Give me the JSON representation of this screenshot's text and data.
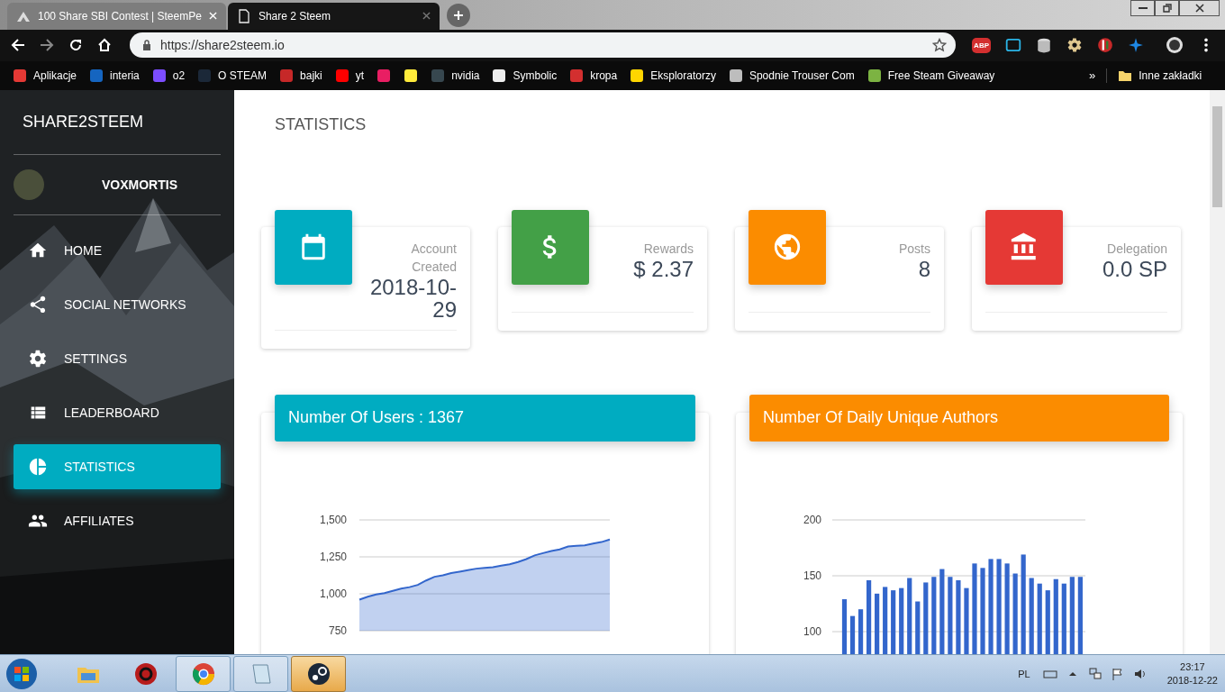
{
  "browser": {
    "tabs": [
      {
        "title": "100 Share SBI Contest | SteemPe",
        "selected": false
      },
      {
        "title": "Share 2 Steem",
        "selected": true
      }
    ],
    "url": "https://share2steem.io",
    "extensions": [
      "ABP"
    ],
    "bookmarks": [
      {
        "kind": "link",
        "label": "Aplikacje"
      },
      {
        "kind": "link",
        "label": "interia"
      },
      {
        "kind": "link",
        "label": "o2"
      },
      {
        "kind": "link",
        "label": "O STEAM"
      },
      {
        "kind": "link",
        "label": "bajki"
      },
      {
        "kind": "link",
        "label": "yt"
      },
      {
        "kind": "icon"
      },
      {
        "kind": "icon"
      },
      {
        "kind": "link",
        "label": "nvidia"
      },
      {
        "kind": "link",
        "label": "Symbolic"
      },
      {
        "kind": "link",
        "label": "kropa"
      },
      {
        "kind": "link",
        "label": "Eksploratorzy"
      },
      {
        "kind": "link",
        "label": "Spodnie Trouser Com"
      },
      {
        "kind": "link",
        "label": "Free Steam Giveaway"
      }
    ],
    "more": "»",
    "other_bookmarks": "Inne zakładki"
  },
  "sidebar": {
    "brand": "SHARE2STEEM",
    "user": "VOXMORTIS",
    "items": [
      {
        "label": "HOME",
        "selected": false
      },
      {
        "label": "SOCIAL NETWORKS",
        "selected": false
      },
      {
        "label": "SETTINGS",
        "selected": false
      },
      {
        "label": "LEADERBOARD",
        "selected": false
      },
      {
        "label": "STATISTICS",
        "selected": true
      },
      {
        "label": "AFFILIATES",
        "selected": false
      }
    ]
  },
  "page_title": "STATISTICS",
  "stats": [
    {
      "label": "Account Created",
      "value": "2018-10-29",
      "color": "#00acc1"
    },
    {
      "label": "Rewards",
      "value": "$ 2.37",
      "color": "#43a047"
    },
    {
      "label": "Posts",
      "value": "8",
      "color": "#fb8c00"
    },
    {
      "label": "Delegation",
      "value": "0.0 SP",
      "color": "#e53935"
    }
  ],
  "charts": [
    {
      "title": "Number Of Users : 1367",
      "color": "#00acc1",
      "chart_data": {
        "type": "area",
        "grid": true,
        "ylim": [
          750,
          1500
        ],
        "yticks": [
          750,
          {
            "value": 1000,
            "label": "1,000"
          },
          {
            "value": 1250,
            "label": "1,250"
          },
          {
            "value": 1500,
            "label": "1,500"
          }
        ],
        "series": [
          {
            "color": "#3366cc",
            "values": [
              960,
              980,
              995,
              1005,
              1020,
              1035,
              1045,
              1060,
              1090,
              1115,
              1125,
              1140,
              1150,
              1160,
              1170,
              1175,
              1180,
              1190,
              1200,
              1215,
              1235,
              1260,
              1275,
              1290,
              1300,
              1320,
              1325,
              1328,
              1340,
              1350,
              1367
            ]
          }
        ]
      }
    },
    {
      "title": "Number Of Daily Unique Authors",
      "color": "#fb8c00",
      "chart_data": {
        "type": "bar",
        "grid": true,
        "ylim": [
          77,
          200
        ],
        "yticks": [
          100,
          150,
          200
        ],
        "series": [
          {
            "color": "#3366cc",
            "values": [
              129,
              114,
              120,
              146,
              134,
              140,
              137,
              139,
              148,
              127,
              144,
              149,
              156,
              149,
              146,
              139,
              161,
              157,
              165,
              165,
              161,
              152,
              169,
              148,
              143,
              137,
              147,
              143,
              149,
              149
            ]
          }
        ]
      }
    }
  ],
  "taskbar": {
    "apps": [
      {
        "running": false,
        "selected": false
      },
      {
        "running": false,
        "selected": false
      },
      {
        "running": true,
        "selected": false
      },
      {
        "running": true,
        "selected": false
      },
      {
        "running": true,
        "selected": true
      }
    ],
    "language": "PL",
    "time": "23:17",
    "date": "2018-12-22"
  }
}
